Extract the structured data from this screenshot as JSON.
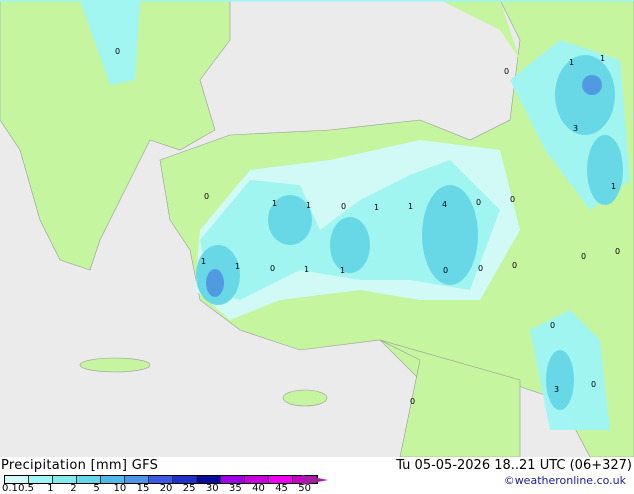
{
  "title": "Precipitation [mm]  GFS",
  "date": "Tu 05-05-2026 18..21 UTC (06+327)",
  "credit": "©weatheronline.co.uk",
  "colors": {
    "sea": "#ebebeb",
    "land": "#c6f5a0"
  },
  "legend": {
    "ticks": [
      "0.1",
      "0.5",
      "1",
      "2",
      "5",
      "10",
      "15",
      "20",
      "25",
      "30",
      "35",
      "40",
      "45",
      "50"
    ],
    "colors": [
      "#d2fafa",
      "#a0f5f5",
      "#82ebeb",
      "#64d7eb",
      "#50b9eb",
      "#4b96e6",
      "#3c5ae6",
      "#1e32c8",
      "#0a0a9b",
      "#a000e6",
      "#c800dc",
      "#f000f0",
      "#c800c8"
    ]
  },
  "map_labels": [
    "0",
    "0",
    "1",
    "1",
    "3",
    "1",
    "0",
    "1",
    "1",
    "0",
    "1",
    "1",
    "4",
    "0",
    "0",
    "1",
    "1",
    "0",
    "1",
    "1",
    "0",
    "0",
    "0",
    "0",
    "0",
    "0",
    "3",
    "0",
    "0"
  ]
}
